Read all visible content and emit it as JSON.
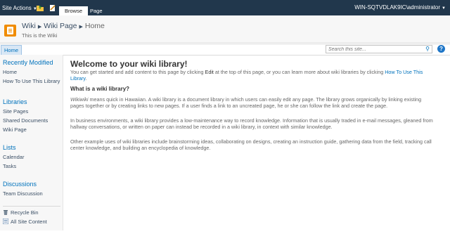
{
  "ribbon": {
    "site_actions": "Site Actions",
    "tabs": [
      "Browse",
      "Page"
    ],
    "user": "WIN-SQTVDLAK9IC\\administrator"
  },
  "title_area": {
    "breadcrumb": [
      "Wiki",
      "Wiki Page",
      "Home"
    ],
    "description": "This is the Wiki"
  },
  "top_nav": {
    "home": "Home",
    "search_placeholder": "Search this site...",
    "help": "?"
  },
  "quick_launch": {
    "recently_modified": {
      "heading": "Recently Modified",
      "items": [
        "Home",
        "How To Use This Library"
      ]
    },
    "libraries": {
      "heading": "Libraries",
      "items": [
        "Site Pages",
        "Shared Documents",
        "Wiki Page"
      ]
    },
    "lists": {
      "heading": "Lists",
      "items": [
        "Calendar",
        "Tasks"
      ]
    },
    "discussions": {
      "heading": "Discussions",
      "items": [
        "Team Discussion"
      ]
    },
    "recycle_bin": "Recycle Bin",
    "all_site_content": "All Site Content"
  },
  "content": {
    "heading": "Welcome to your wiki library!",
    "intro_pre": "You can get started and add content to this page by clicking ",
    "intro_edit": "Edit",
    "intro_mid": " at the top of this page, or you can learn more about wiki libraries by clicking ",
    "intro_link": "How To Use This Library",
    "intro_end": ".",
    "subheading": "What is a wiki library?",
    "para1_italic": "Wikiwiki",
    "para1": " means quick in Hawaiian. A wiki library is a document library in which users can easily edit any page. The library grows organically by linking existing pages together or by creating links to new pages. If a user finds a link to an uncreated page, he or she can follow the link and create the page.",
    "para2": "In business environments, a wiki library provides a low-maintenance way to record knowledge. Information that is usually traded in e-mail messages, gleaned from hallway conversations, or written on paper can instead be recorded in a wiki library, in context with similar knowledge.",
    "para3": "Other example uses of wiki libraries include brainstorming ideas, collaborating on designs, creating an instruction guide, gathering data from the field, tracking call center knowledge, and building an encyclopedia of knowledge."
  }
}
